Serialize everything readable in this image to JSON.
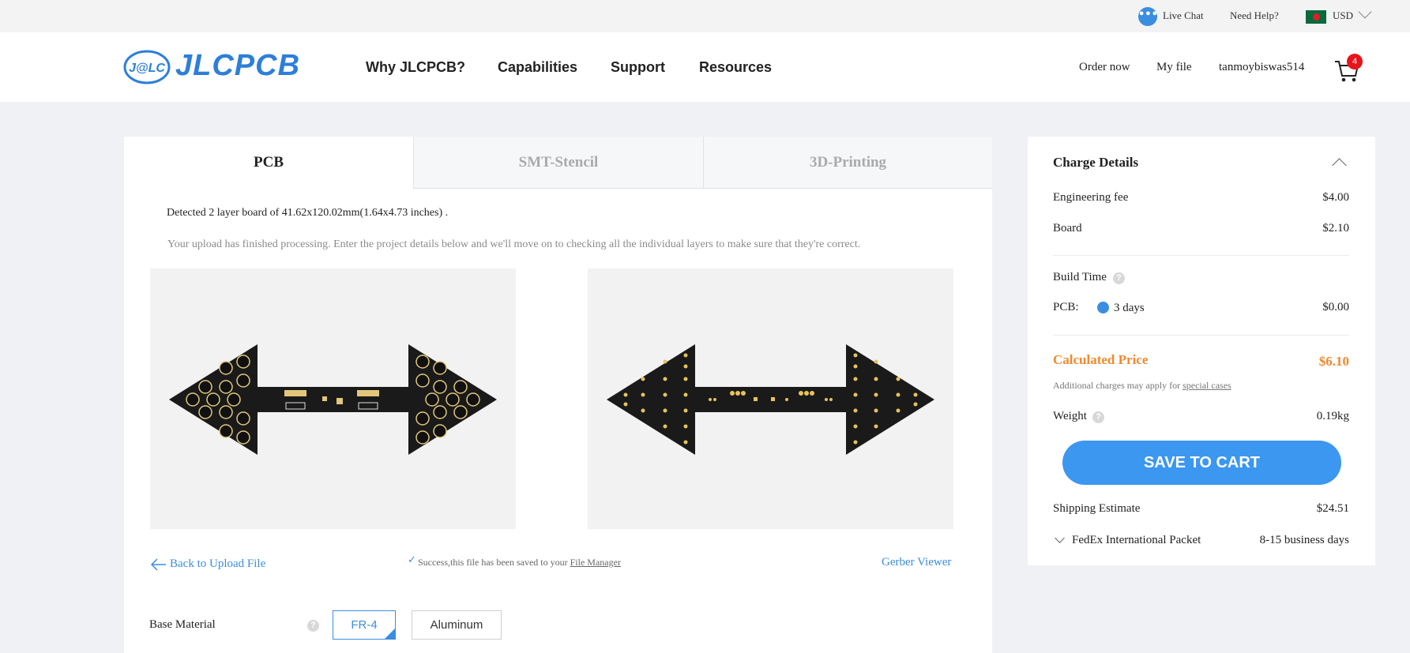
{
  "topbar": {
    "live_chat": "Live Chat",
    "need_help": "Need Help?",
    "currency": "USD",
    "live_chat_icon": "chat-dots-icon"
  },
  "header": {
    "logo_text": "JLCPCB",
    "logo_mark_text": "J@LC",
    "nav": [
      "Why JLCPCB?",
      "Capabilities",
      "Support",
      "Resources"
    ],
    "order_now": "Order now",
    "my_file": "My file",
    "username": "tanmoybiswas514",
    "cart_count": "4",
    "brand_color": "#2d7fd8"
  },
  "tabs": [
    {
      "label": "PCB",
      "active": true
    },
    {
      "label": "SMT-Stencil",
      "active": false
    },
    {
      "label": "3D-Printing",
      "active": false
    }
  ],
  "main": {
    "detect_text": "Detected 2 layer board of 41.62x120.02mm(1.64x4.73 inches) .",
    "upload_note": "Your upload has finished processing. Enter the project details below and we'll move on to checking all the individual layers to make sure that they're correct.",
    "back_link": "Back to Upload File",
    "success_prefix": "Success,this file has been saved to your ",
    "file_manager": "File Manager",
    "gerber_viewer": "Gerber Viewer",
    "base_material_label": "Base Material",
    "base_material_options": [
      "FR-4",
      "Aluminum"
    ],
    "base_material_selected": "FR-4"
  },
  "charge": {
    "title": "Charge Details",
    "engineering_fee_label": "Engineering fee",
    "engineering_fee": "$4.00",
    "board_label": "Board",
    "board": "$2.10",
    "build_time_label": "Build Time",
    "pcb_label": "PCB:",
    "pcb_days": "3 days",
    "pcb_price": "$0.00",
    "calculated_label": "Calculated Price",
    "calculated_price": "$6.10",
    "addl_note": "Additional charges may apply for ",
    "special_cases": "special cases",
    "weight_label": "Weight",
    "weight": "0.19kg",
    "save_button": "SAVE TO CART",
    "shipping_label": "Shipping Estimate",
    "shipping_price": "$24.51",
    "shipping_method": "FedEx International Packet",
    "shipping_time": "8-15 business days",
    "accent_color": "#3b8de0",
    "price_color": "#f0892f"
  }
}
